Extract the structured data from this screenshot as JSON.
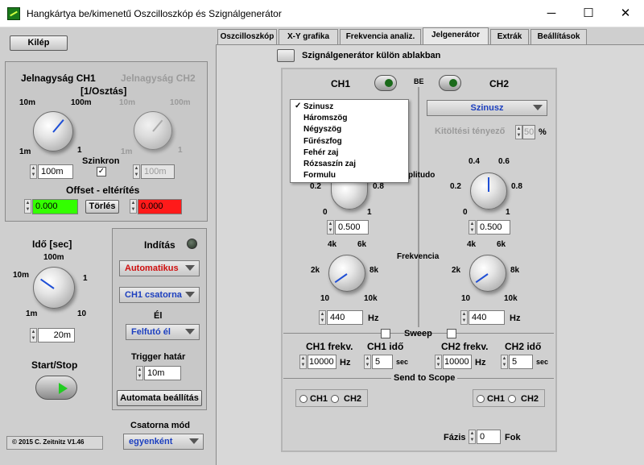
{
  "window": {
    "title": "Hangkártya be/kimenetű Oszcilloszkóp és Szignálgenerátor"
  },
  "left": {
    "exit_label": "Kilép",
    "ch1_label": "Jelnagyság CH1",
    "ch2_label": "Jelnagyság CH2",
    "unit_label": "[1/Osztás]",
    "knob_ticks": {
      "min": "1m",
      "low": "10m",
      "high": "100m",
      "max": "1"
    },
    "ch1_value": "100m",
    "ch2_value": "100m",
    "sync_label": "Szinkron",
    "offset_label": "Offset - eltérítés",
    "offset_ch1": "0.000",
    "offset_ch2": "0.000",
    "clear_label": "Törlés",
    "time_label": "Idő [sec]",
    "time_ticks": {
      "min": "1m",
      "low": "10m",
      "high": "100m",
      "mid": "1",
      "max": "10"
    },
    "time_value": "20m",
    "startstop_label": "Start/Stop",
    "copyright": "© 2015  C. Zeitnitz V1.46"
  },
  "trigger": {
    "start_label": "Indítás",
    "mode": "Automatikus",
    "channel": "CH1 csatorna",
    "edge_label": "Él",
    "edge": "Felfutó él",
    "threshold_label": "Trigger határ",
    "threshold": "10m",
    "auto_label": "Automata beállítás",
    "channel_mode_label": "Csatorna mód",
    "channel_mode": "egyenként"
  },
  "tabs": [
    "Oszcilloszkóp",
    "X-Y grafika",
    "Frekvencia analiz.",
    "Jelgenerátor",
    "Extrák",
    "Beállítások"
  ],
  "gen": {
    "separate_window": "Szignálgenerátor külön ablakban",
    "ch1": "CH1",
    "ch2": "CH2",
    "be": "BE",
    "ch2_wave": "Szinusz",
    "duty_label": "Kitöltési tényező",
    "duty_value": "50",
    "percent": "%",
    "amp_label": "plitudo",
    "amp_ticks": {
      "min": "0",
      "low": "0.2",
      "high": "0.8",
      "max": "1",
      "ul": "0.4",
      "ur": "0.6"
    },
    "ch1_amp": "0.500",
    "ch2_amp": "0.500",
    "freq_label": "Frekvencia",
    "freq_ticks": {
      "k2": "2k",
      "k4": "4k",
      "k6": "6k",
      "k8": "8k",
      "t10": "10",
      "k10": "10k"
    },
    "ch1_freq": "440",
    "ch2_freq": "440",
    "hz": "Hz",
    "sweep_label": "Sweep",
    "ch1_frekv_label": "CH1 frekv.",
    "ch1_ido_label": "CH1 idő",
    "ch2_frekv_label": "CH2 frekv.",
    "ch2_ido_label": "CH2 idő",
    "ch1_sweep_freq": "10000",
    "ch1_sweep_time": "5",
    "ch2_sweep_freq": "10000",
    "ch2_sweep_time": "5",
    "sec": "sec",
    "send_scope": "Send to Scope",
    "r_ch1": "CH1",
    "r_ch2": "CH2",
    "phase_label": "Fázis",
    "phase_value": "0",
    "phase_unit": "Fok"
  },
  "menu": {
    "checked": "✓",
    "items": [
      "Szinusz",
      "Háromszög",
      "Négyszög",
      "Fűrészfog",
      "Fehér zaj",
      "Rózsaszín zaj",
      "Formulu"
    ]
  },
  "colors": {
    "offset_ch1": "#33ff00",
    "offset_ch2": "#ff1a1a",
    "accent_red": "#d01010",
    "accent_blue": "#1c3fbf"
  }
}
